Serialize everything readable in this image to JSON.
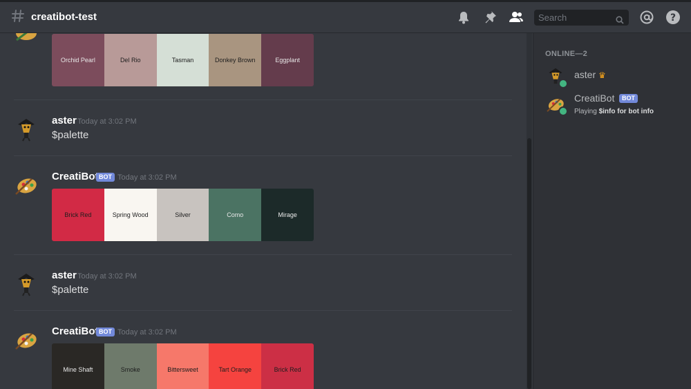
{
  "header": {
    "channel": "creatibot-test",
    "search_placeholder": "Search"
  },
  "messages": [
    {
      "type": "palette",
      "swatches": [
        {
          "name": "Orchid Pearl",
          "color": "#7c4c5c",
          "dark": true
        },
        {
          "name": "Del Rio",
          "color": "#b89a98",
          "dark": false
        },
        {
          "name": "Tasman",
          "color": "#d5dfd6",
          "dark": false
        },
        {
          "name": "Donkey Brown",
          "color": "#a99580",
          "dark": false
        },
        {
          "name": "Eggplant",
          "color": "#643c4c",
          "dark": true
        }
      ]
    },
    {
      "type": "user",
      "author": "aster",
      "timestamp": "Today at 3:02 PM",
      "text": "$palette"
    },
    {
      "type": "bot",
      "author": "CreatiBot",
      "badge": "BOT",
      "timestamp": "Today at 3:02 PM",
      "swatches": [
        {
          "name": "Brick Red",
          "color": "#d22a45",
          "dark": false
        },
        {
          "name": "Spring Wood",
          "color": "#f9f6f1",
          "dark": false
        },
        {
          "name": "Silver",
          "color": "#c8c3bf",
          "dark": false
        },
        {
          "name": "Como",
          "color": "#4b7363",
          "dark": true
        },
        {
          "name": "Mirage",
          "color": "#1c2a29",
          "dark": true
        }
      ]
    },
    {
      "type": "user",
      "author": "aster",
      "timestamp": "Today at 3:02 PM",
      "text": "$palette"
    },
    {
      "type": "bot",
      "author": "CreatiBot",
      "badge": "BOT",
      "timestamp": "Today at 3:02 PM",
      "swatches": [
        {
          "name": "Mine Shaft",
          "color": "#2a2825",
          "dark": true
        },
        {
          "name": "Smoke",
          "color": "#6e7a6b",
          "dark": false
        },
        {
          "name": "Bittersweet",
          "color": "#f6786a",
          "dark": false
        },
        {
          "name": "Tart Orange",
          "color": "#f5433f",
          "dark": false
        },
        {
          "name": "Brick Red",
          "color": "#cc2f45",
          "dark": false
        }
      ]
    }
  ],
  "members": {
    "heading": "ONLINE—2",
    "list": [
      {
        "name": "aster",
        "crown": "♛"
      },
      {
        "name": "CreatiBot",
        "badge": "BOT",
        "activity_prefix": "Playing ",
        "activity_name": "$info for bot info"
      }
    ]
  },
  "icons": [
    "hashtag-icon",
    "bell-icon",
    "pin-icon",
    "members-icon",
    "search-icon",
    "mention-icon",
    "help-icon"
  ],
  "colors": {
    "background": "#36393f",
    "sidebar": "#2f3136",
    "bot_badge": "#7289da",
    "online": "#43b581"
  }
}
